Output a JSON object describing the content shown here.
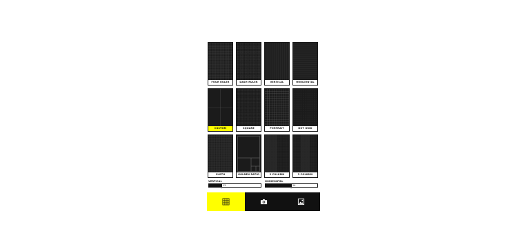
{
  "grids": [
    {
      "label": "FOUR RULER",
      "pattern": "fine",
      "selected": false
    },
    {
      "label": "DASH RULER",
      "pattern": "fine-dash",
      "selected": false
    },
    {
      "label": "VERTICAL",
      "pattern": "vertical",
      "selected": false
    },
    {
      "label": "HORIZONTAL",
      "pattern": "horizontal",
      "selected": false
    },
    {
      "label": "CUSTOM",
      "pattern": "thirds",
      "selected": true
    },
    {
      "label": "SQUARE",
      "pattern": "square",
      "selected": false
    },
    {
      "label": "PORTRAIT",
      "pattern": "portrait",
      "selected": false
    },
    {
      "label": "DOT GRID",
      "pattern": "dots",
      "selected": false
    },
    {
      "label": "CLOTH",
      "pattern": "cloth",
      "selected": false
    },
    {
      "label": "GOLDEN RATIO",
      "pattern": "golden",
      "selected": false
    },
    {
      "label": "2 COLUMN",
      "pattern": "two-col",
      "selected": false
    },
    {
      "label": "3 COLUMN",
      "pattern": "three-col",
      "selected": false
    }
  ],
  "sliders": {
    "vertical": {
      "label": "VERTICAL",
      "value": "12",
      "fraction": 0.25
    },
    "horizontal": {
      "label": "HORIZONTAL",
      "value": "24",
      "fraction": 0.5
    }
  },
  "tabs": [
    {
      "name": "grid-icon",
      "active": true
    },
    {
      "name": "camera-icon",
      "active": false
    },
    {
      "name": "gallery-icon",
      "active": false
    }
  ],
  "colors": {
    "accent": "#ffff00",
    "dark": "#1b1b1b",
    "line": "#5a5a5a"
  }
}
